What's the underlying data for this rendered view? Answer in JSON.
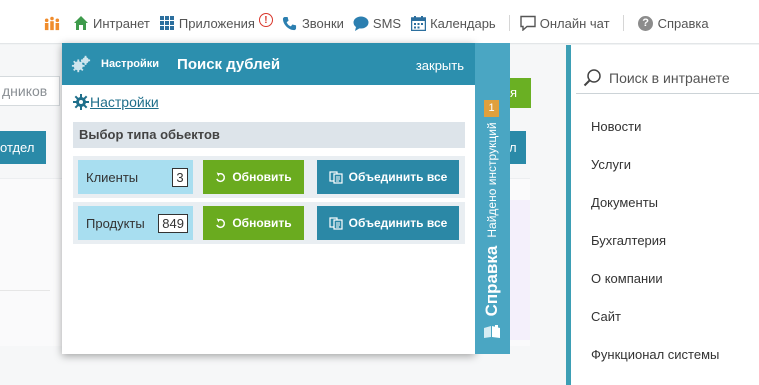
{
  "topnav": {
    "items": [
      {
        "label": "Интранет",
        "icon": "home-icon"
      },
      {
        "label": "Приложения",
        "icon": "grid-icon",
        "alert": "!"
      },
      {
        "label": "Звонки",
        "icon": "phone-icon"
      },
      {
        "label": "SMS",
        "icon": "chat-bubble-icon"
      },
      {
        "label": "Календарь",
        "icon": "calendar-icon"
      },
      {
        "label": "Онлайн чат",
        "icon": "message-icon"
      },
      {
        "label": "Справка",
        "icon": "help-icon"
      }
    ],
    "help_symbol": "?"
  },
  "background": {
    "input_text": "дников",
    "green_button": "я",
    "left_button": "отдел",
    "right_button": "л"
  },
  "sidebar": {
    "search_placeholder": "Поиск в интранете",
    "menu": [
      "Новости",
      "Услуги",
      "Документы",
      "Бухгалтерия",
      "О компании",
      "Сайт",
      "Функционал системы"
    ]
  },
  "popup": {
    "header": {
      "settings_label": "Настройки",
      "title": "Поиск дублей",
      "close_label": "закрыть"
    },
    "settings_link": "Настройки",
    "type_header": "Выбор типа обьектов",
    "rows": [
      {
        "label": "Клиенты",
        "count": "3",
        "refresh_label": "Обновить",
        "merge_label": "Объединить все"
      },
      {
        "label": "Продукты",
        "count": "849",
        "refresh_label": "Обновить",
        "merge_label": "Объединить все"
      }
    ]
  },
  "help_tab": {
    "count": "1",
    "found_label": "Найдено инструкций",
    "label": "Справка"
  },
  "colors": {
    "header_teal": "#2c8fae",
    "green": "#6aab1f",
    "teal_button": "#2b88a6",
    "label_blue": "#a8def0",
    "help_tab": "#4aa6c3",
    "badge_orange": "#e0a03d"
  }
}
